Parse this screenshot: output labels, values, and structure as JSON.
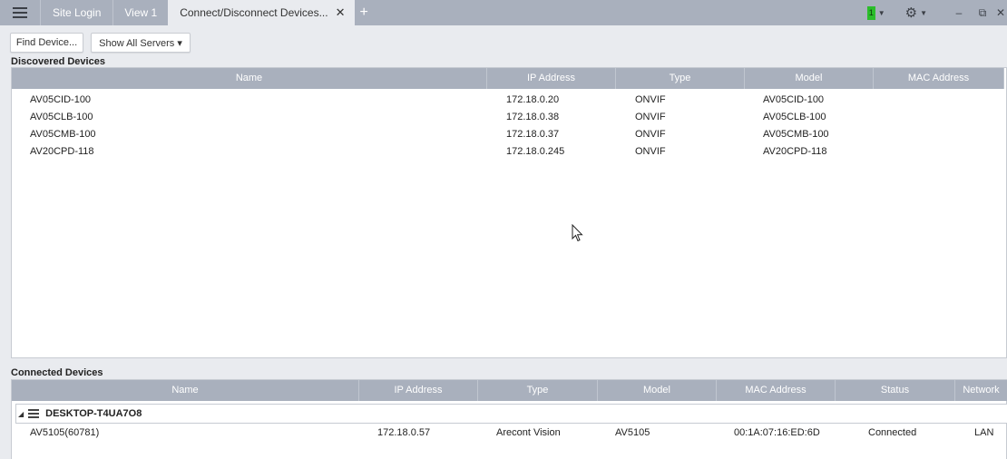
{
  "tabs": {
    "site_login": "Site Login",
    "view1": "View 1",
    "connect": "Connect/Disconnect Devices...",
    "close": "✕",
    "add": "+"
  },
  "top_right": {
    "notification_count": "1",
    "minimize": "–",
    "restore": "⧉",
    "close": "✕"
  },
  "toolbar": {
    "find_device": "Find Device...",
    "show_servers": "Show All Servers ▾"
  },
  "discovered": {
    "title": "Discovered Devices",
    "columns": [
      "Name",
      "IP Address",
      "Type",
      "Model",
      "MAC Address"
    ],
    "rows": [
      {
        "name": "AV05CID-100",
        "ip": "172.18.0.20",
        "type": "ONVIF",
        "model": "AV05CID-100",
        "mac": ""
      },
      {
        "name": "AV05CLB-100",
        "ip": "172.18.0.38",
        "type": "ONVIF",
        "model": "AV05CLB-100",
        "mac": ""
      },
      {
        "name": "AV05CMB-100",
        "ip": "172.18.0.37",
        "type": "ONVIF",
        "model": "AV05CMB-100",
        "mac": ""
      },
      {
        "name": "AV20CPD-118",
        "ip": "172.18.0.245",
        "type": "ONVIF",
        "model": "AV20CPD-118",
        "mac": ""
      }
    ]
  },
  "connected": {
    "title": "Connected Devices",
    "columns": [
      "Name",
      "IP Address",
      "Type",
      "Model",
      "MAC Address",
      "Status",
      "Network"
    ],
    "group": "DESKTOP-T4UA7O8",
    "rows": [
      {
        "name": "AV5105(60781)",
        "ip": "172.18.0.57",
        "type": "Arecont Vision",
        "model": "AV5105",
        "mac": "00:1A:07:16:ED:6D",
        "status": "Connected",
        "network": "LAN"
      }
    ]
  },
  "colors": {
    "header_bar": "#a9b0bd",
    "background": "#e9ebef",
    "notification_green": "#2bbd2b"
  }
}
